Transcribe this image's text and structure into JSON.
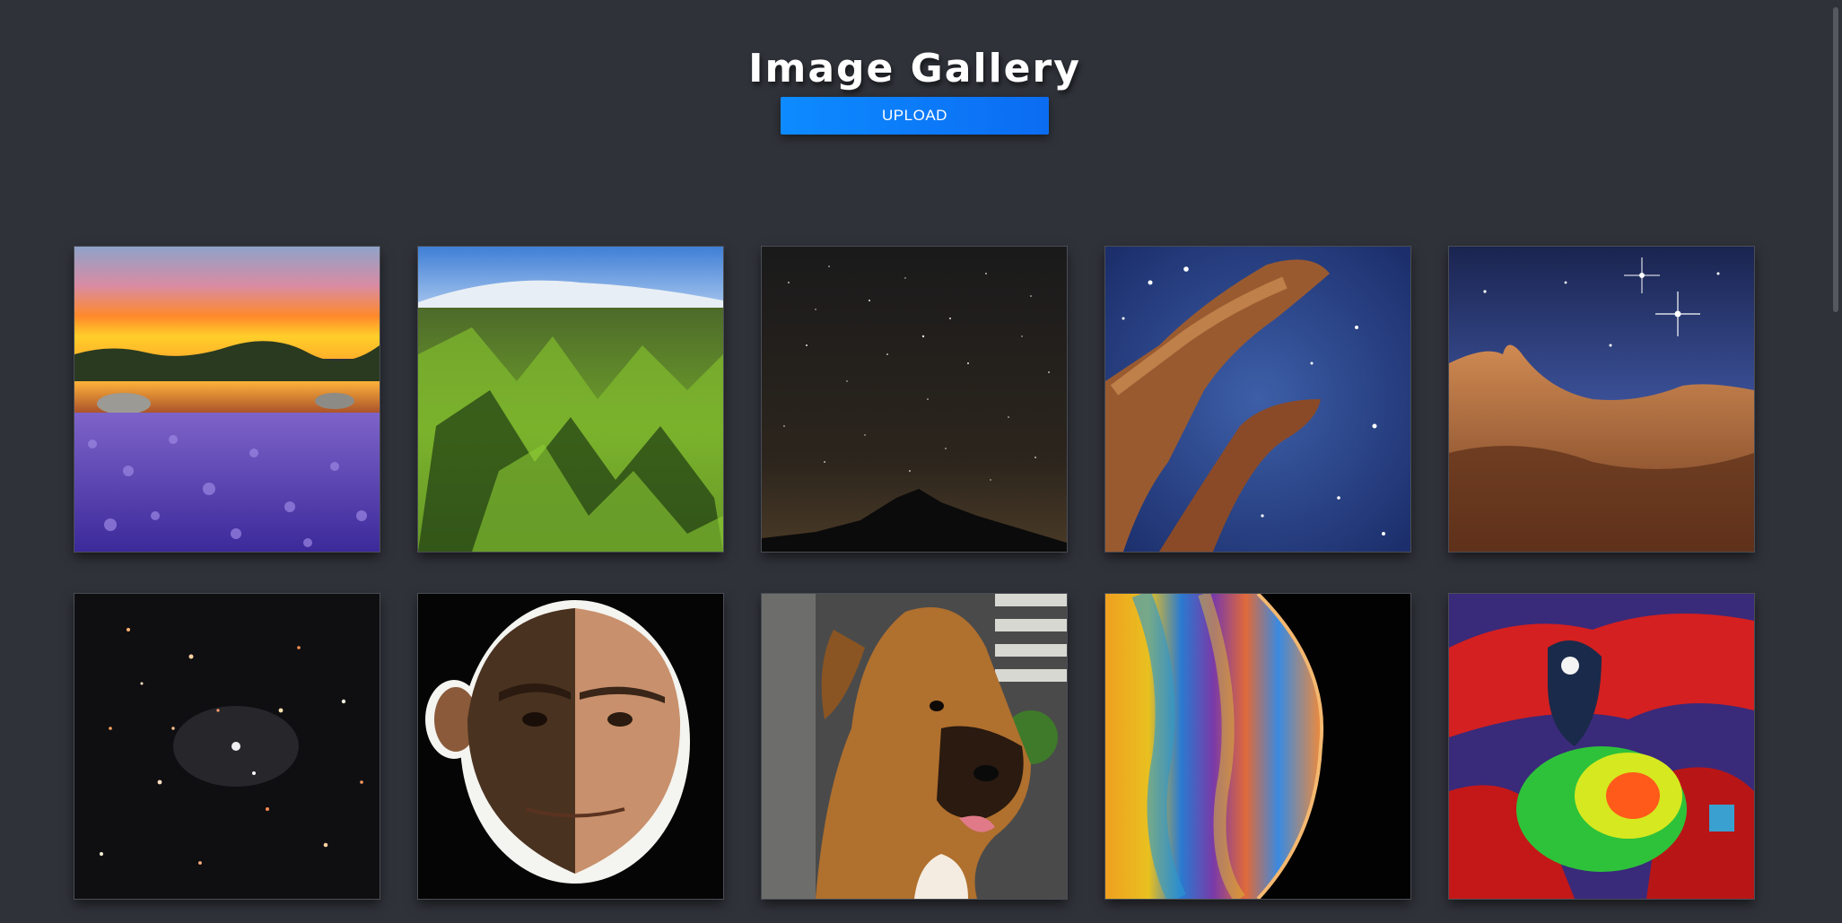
{
  "header": {
    "title": "Image Gallery",
    "upload_label": "UPLOAD"
  },
  "gallery": {
    "images": [
      {
        "subject": "sunset-lake-lupine-field"
      },
      {
        "subject": "green-mountain-aerial"
      },
      {
        "subject": "starry-night-mountain"
      },
      {
        "subject": "pillars-of-creation-nebula"
      },
      {
        "subject": "cosmic-cliffs-nebula"
      },
      {
        "subject": "deep-field-galaxies"
      },
      {
        "subject": "half-chimp-half-man-face"
      },
      {
        "subject": "boxer-puppy"
      },
      {
        "subject": "soap-bubble-planet"
      },
      {
        "subject": "spawn-comic-art"
      }
    ]
  },
  "colors": {
    "background": "#2f3239",
    "accent": "#0d8bff"
  }
}
